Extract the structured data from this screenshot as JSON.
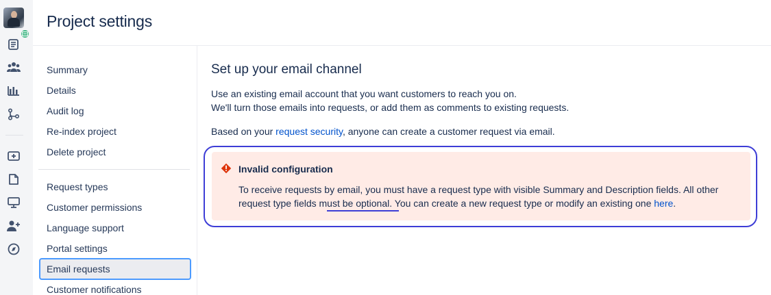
{
  "header": {
    "title": "Project settings"
  },
  "rail": {
    "icons": [
      "avatar",
      "document-icon",
      "people-icon",
      "bar-chart-icon",
      "git-branch-icon",
      "add-ticket-icon",
      "page-icon",
      "monitor-icon",
      "add-user-icon",
      "compass-icon"
    ]
  },
  "nav": {
    "group1": [
      "Summary",
      "Details",
      "Audit log",
      "Re-index project",
      "Delete project"
    ],
    "group2": [
      "Request types",
      "Customer permissions",
      "Language support",
      "Portal settings",
      "Email requests",
      "Customer notifications"
    ],
    "selected": "Email requests"
  },
  "main": {
    "heading": "Set up your email channel",
    "intro_line1": "Use an existing email account that you want customers to reach you on.",
    "intro_line2": "We'll turn those emails into requests, or add them as comments to existing requests.",
    "security_prefix": "Based on your ",
    "security_link": "request security",
    "security_suffix": ", anyone can create a customer request via email."
  },
  "alert": {
    "title": "Invalid configuration",
    "line1": "To receive requests by email, you must have a request type with visible Summary and Description fields. All other",
    "line2_prefix": "request type fields must be optional. You can create a new request type or modify an existing one ",
    "line2_link": "here",
    "line2_suffix": ".",
    "colors": {
      "background": "#ffebe6",
      "icon": "#de350b",
      "highlight": "#3d3dd6"
    }
  }
}
